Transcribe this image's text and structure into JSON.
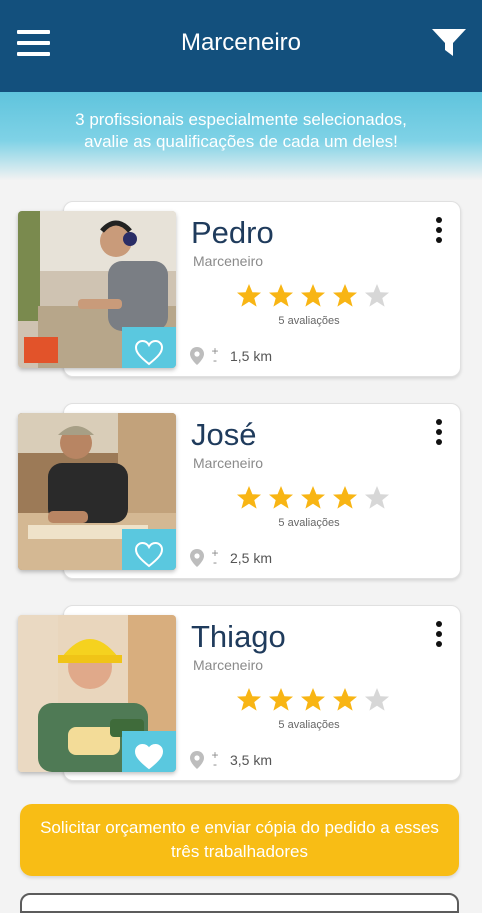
{
  "header": {
    "title": "Marceneiro",
    "menu_icon": "hamburger-menu-icon",
    "filter_icon": "filter-funnel-icon"
  },
  "banner": {
    "line1": "3 profissionais especialmente selecionados,",
    "line2": "avalie as qualificações de cada um deles!"
  },
  "colors": {
    "header_bg": "#13507d",
    "banner": "#5fc4dd",
    "heart_bg": "#5ac8df",
    "star": "#f8b514",
    "star_empty": "#d7d7d7",
    "cta": "#f8bd15"
  },
  "workers": [
    {
      "name": "Pedro",
      "role": "Marceneiro",
      "rating": 4,
      "max_rating": 5,
      "reviews": "5 avaliações",
      "distance_prefix": "+-",
      "distance": "1,5 km",
      "favorited": false
    },
    {
      "name": "José",
      "role": "Marceneiro",
      "rating": 4,
      "max_rating": 5,
      "reviews": "5 avaliações",
      "distance_prefix": "+-",
      "distance": "2,5 km",
      "favorited": false
    },
    {
      "name": "Thiago",
      "role": "Marceneiro",
      "rating": 4,
      "max_rating": 5,
      "reviews": "5 avaliações",
      "distance_prefix": "+-",
      "distance": "3,5 km",
      "favorited": true
    }
  ],
  "cta": {
    "label": "Solicitar orçamento e enviar cópia do pedido a esses três trabalhadores"
  }
}
